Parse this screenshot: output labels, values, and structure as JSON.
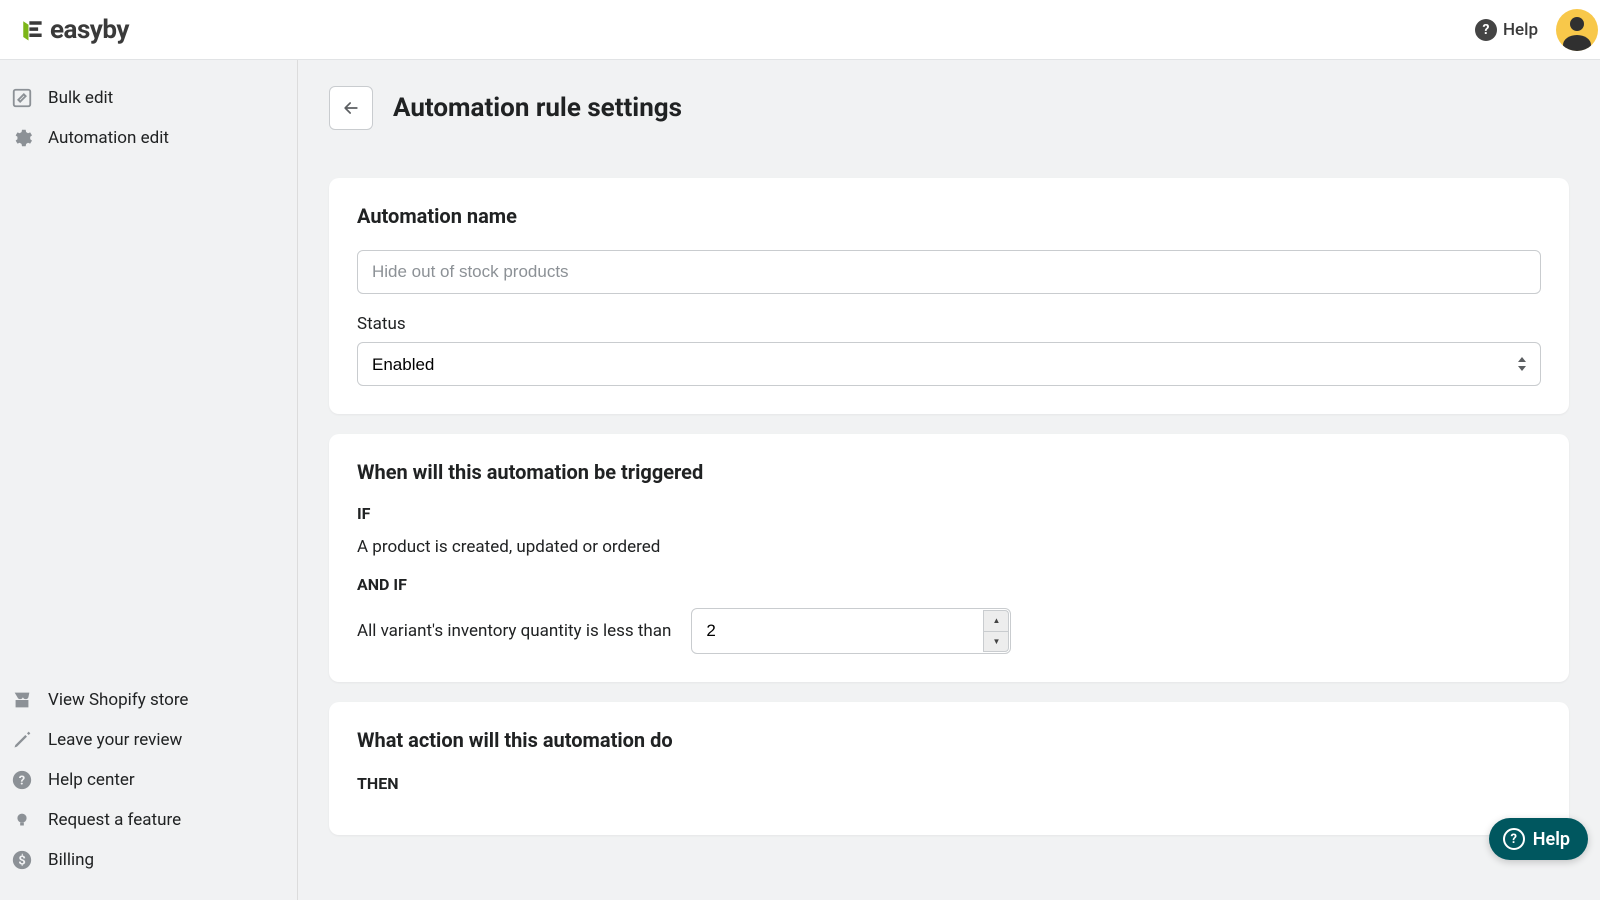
{
  "header": {
    "brand": "easyby",
    "help_label": "Help"
  },
  "sidebar": {
    "top": [
      {
        "label": "Bulk edit"
      },
      {
        "label": "Automation edit"
      }
    ],
    "bottom": [
      {
        "label": "View Shopify store"
      },
      {
        "label": "Leave your review"
      },
      {
        "label": "Help center"
      },
      {
        "label": "Request a feature"
      },
      {
        "label": "Billing"
      }
    ]
  },
  "page": {
    "title": "Automation rule settings"
  },
  "card_name": {
    "heading": "Automation name",
    "placeholder": "Hide out of stock products",
    "value": "",
    "status_label": "Status",
    "status_value": "Enabled"
  },
  "card_trigger": {
    "heading": "When will this automation be triggered",
    "if_label": "IF",
    "if_text": "A product is created, updated or ordered",
    "andif_label": "AND IF",
    "andif_text": "All variant's inventory quantity is less than",
    "qty_value": "2"
  },
  "card_action": {
    "heading": "What action will this automation do",
    "then_label": "THEN"
  },
  "help_widget": {
    "label": "Help"
  }
}
